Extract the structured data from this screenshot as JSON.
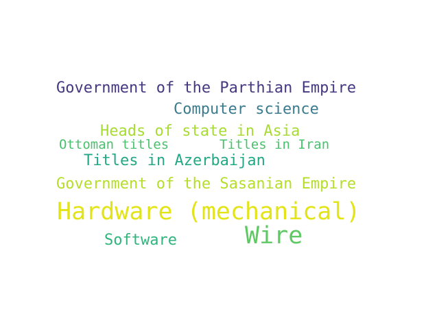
{
  "cloud": {
    "words": [
      {
        "text": "Government of the Parthian Empire",
        "color": "#453781"
      },
      {
        "text": "Computer science",
        "color": "#3b7b8e"
      },
      {
        "text": "Heads of state in Asia",
        "color": "#a8db34"
      },
      {
        "text": "Ottoman titles",
        "color": "#4ac16d"
      },
      {
        "text": "Titles in Iran",
        "color": "#4ac16d"
      },
      {
        "text": "Titles in Azerbaijan",
        "color": "#22a884"
      },
      {
        "text": "Government of the Sasanian Empire",
        "color": "#b5de2b"
      },
      {
        "text": "Hardware (mechanical)",
        "color": "#e3e418"
      },
      {
        "text": "Wire",
        "color": "#5ec962"
      },
      {
        "text": "Software",
        "color": "#2fb47c"
      }
    ]
  }
}
